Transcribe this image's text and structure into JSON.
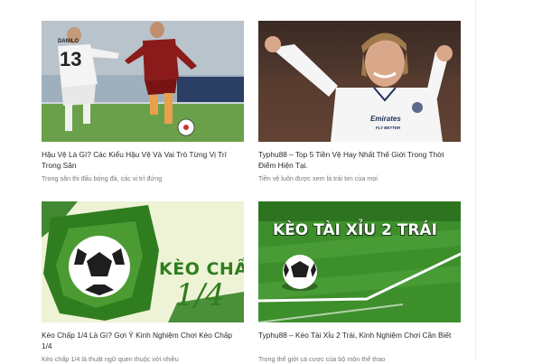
{
  "articles": [
    {
      "title": "Hậu Vệ Là Gì? Các Kiểu Hậu Vệ Và Vai Trò Từng Vị Trí Trong Sân",
      "excerpt": "Trong sân thi đấu bóng đá, các vị trí đứng",
      "image": {
        "jersey_number": "13",
        "jersey_name": "DANILO"
      }
    },
    {
      "title": "Typhu88 – Top 5 Tiền Vệ Hay Nhất Thế Giới Trong Thời Điểm Hiện Tại.",
      "excerpt": "Tiền vệ luôn được xem là trái tim của mọi",
      "image": {
        "sponsor": "Emirates",
        "sponsor_sub": "FLY BETTER"
      }
    },
    {
      "title": "Kèo Chấp 1/4 Là Gì? Gợi Ý Kinh Nghiệm Chơi Kèo Chấp 1/4",
      "excerpt": "Kèo chấp 1/4 là thuật ngữ quen thuộc với nhiều",
      "image": {
        "headline": "KÈO CHẤP",
        "fraction": "1/4"
      }
    },
    {
      "title": "Typhu88 – Kèo Tài Xỉu 2 Trái, Kinh Nghiệm Chơi Cần Biết",
      "excerpt": "Trong thế giới cá cược của bộ môn thể thao",
      "image": {
        "headline": "KÈO TÀI XỈU 2 TRÁI"
      }
    }
  ],
  "colors": {
    "accent_green": "#2f7d1f",
    "pitch_green": "#3d8f2c",
    "roma_red": "#8b1a1a",
    "title_text": "#2a2a2a",
    "excerpt_text": "#777777"
  }
}
